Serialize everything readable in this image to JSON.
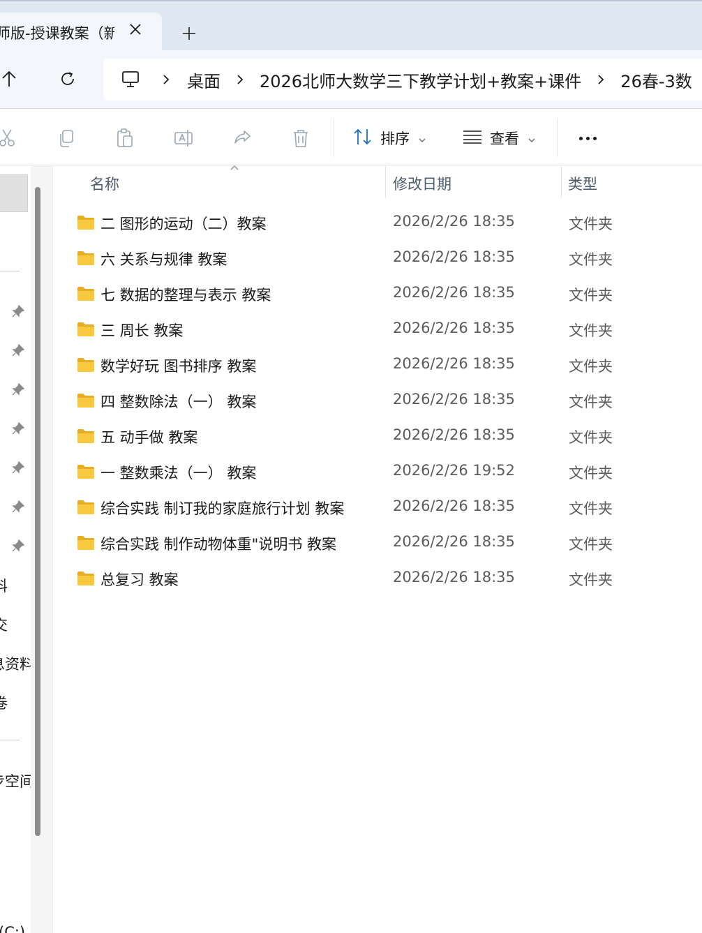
{
  "tab": {
    "title": "师版-授课教案（新",
    "close_icon": "close-icon",
    "new_tab_icon": "plus-icon"
  },
  "address": {
    "crumbs": [
      "桌面",
      "2026北师大数学三下教学计划+教案+课件",
      "26春-3数"
    ]
  },
  "toolbar": {
    "sort_label": "排序",
    "view_label": "查看"
  },
  "nav_pane": {
    "items": [
      "料",
      "交",
      "息资料",
      "卷",
      "步空间",
      "(C:)"
    ]
  },
  "list": {
    "headers": {
      "name": "名称",
      "date": "修改日期",
      "type": "类型"
    },
    "rows": [
      {
        "name": "二 图形的运动（二）教案",
        "date": "2026/2/26 18:35",
        "type": "文件夹"
      },
      {
        "name": "六 关系与规律 教案",
        "date": "2026/2/26 18:35",
        "type": "文件夹"
      },
      {
        "name": "七 数据的整理与表示 教案",
        "date": "2026/2/26 18:35",
        "type": "文件夹"
      },
      {
        "name": "三 周长 教案",
        "date": "2026/2/26 18:35",
        "type": "文件夹"
      },
      {
        "name": "数学好玩 图书排序 教案",
        "date": "2026/2/26 18:35",
        "type": "文件夹"
      },
      {
        "name": "四 整数除法（一） 教案",
        "date": "2026/2/26 18:35",
        "type": "文件夹"
      },
      {
        "name": "五 动手做 教案",
        "date": "2026/2/26 18:35",
        "type": "文件夹"
      },
      {
        "name": "一 整数乘法（一） 教案",
        "date": "2026/2/26 19:52",
        "type": "文件夹"
      },
      {
        "name": "综合实践 制订我的家庭旅行计划 教案",
        "date": "2026/2/26 18:35",
        "type": "文件夹"
      },
      {
        "name": "综合实践 制作动物体重\"说明书 教案",
        "date": "2026/2/26 18:35",
        "type": "文件夹"
      },
      {
        "name": "总复习 教案",
        "date": "2026/2/26 18:35",
        "type": "文件夹"
      }
    ]
  },
  "colors": {
    "tabstrip_bg": "#dfe8f3",
    "folder_yellow": "#f8c93e"
  }
}
